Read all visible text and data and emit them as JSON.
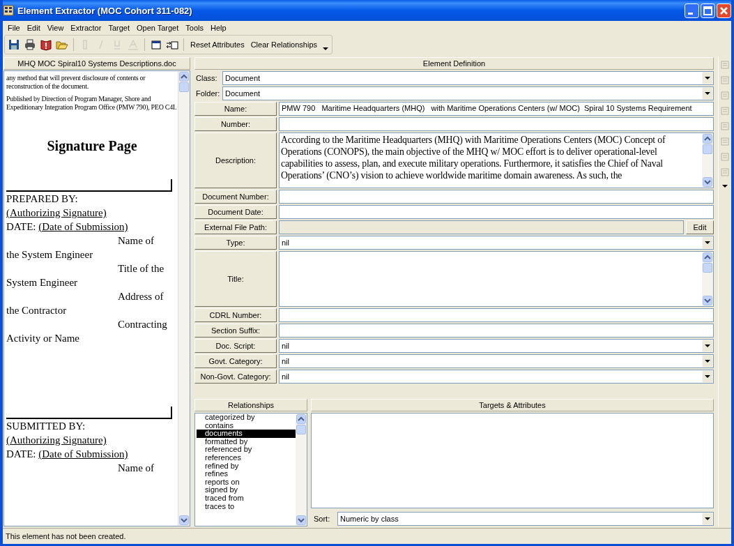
{
  "window": {
    "title": "Element Extractor (MOC Cohort 311-082)"
  },
  "menu": [
    "File",
    "Edit",
    "View",
    "Extractor",
    "Target",
    "Open Target",
    "Tools",
    "Help"
  ],
  "toolbar": {
    "buttons": [
      {
        "kind": "save",
        "disabled": false
      },
      {
        "kind": "print",
        "disabled": false
      },
      {
        "kind": "book",
        "disabled": false
      },
      {
        "kind": "open",
        "disabled": false
      },
      {
        "kind": "sep"
      },
      {
        "kind": "bold",
        "disabled": true
      },
      {
        "kind": "italic",
        "disabled": true
      },
      {
        "kind": "underline",
        "disabled": true
      },
      {
        "kind": "fontcolor",
        "disabled": true
      },
      {
        "kind": "sep"
      },
      {
        "kind": "window",
        "disabled": false
      },
      {
        "kind": "arrowwindow",
        "disabled": false
      }
    ],
    "text_buttons": [
      "Reset Attributes",
      "Clear Relationships"
    ]
  },
  "document": {
    "title": "MHQ MOC Spiral10 Systems Descriptions.doc",
    "blocks": [
      {
        "kind": "small",
        "text": "any method that will prevent disclosure of contents or reconstruction of the document."
      },
      {
        "kind": "small",
        "text": "Published by Direction of Program Manager, Shore and Expeditionary Integration Program Office (PMW 790), PEO C4I."
      },
      {
        "kind": "heading",
        "text": "Signature Page"
      },
      {
        "kind": "rule"
      },
      {
        "kind": "line",
        "text": "PREPARED BY:"
      },
      {
        "kind": "underlined",
        "text": "(Authorizing Signature)"
      },
      {
        "kind": "date",
        "label": "DATE:",
        "text": "(Date of Submission)"
      },
      {
        "kind": "indent",
        "text": "Name of"
      },
      {
        "kind": "line",
        "text": "the System Engineer"
      },
      {
        "kind": "indent",
        "text": "Title of the"
      },
      {
        "kind": "line",
        "text": "System Engineer"
      },
      {
        "kind": "indent",
        "text": "Address of"
      },
      {
        "kind": "line",
        "text": "the Contractor"
      },
      {
        "kind": "indent",
        "text": "Contracting"
      },
      {
        "kind": "line",
        "text": "Activity or Name"
      },
      {
        "kind": "gap"
      },
      {
        "kind": "rule"
      },
      {
        "kind": "line",
        "text": "SUBMITTED BY:"
      },
      {
        "kind": "underlined",
        "text": "(Authorizing Signature)"
      },
      {
        "kind": "date",
        "label": "DATE:",
        "text": "(Date of Submission)"
      },
      {
        "kind": "indent",
        "text": "Name of"
      }
    ]
  },
  "definition": {
    "title": "Element Definition",
    "class": {
      "label": "Class:",
      "value": "Document"
    },
    "folder": {
      "label": "Folder:",
      "value": "Document"
    },
    "fields": [
      {
        "label": "Name:",
        "kind": "text",
        "value": "PMW 790   Maritime Headquarters (MHQ)   with Maritime Operations Centers (w/ MOC)  Spiral 10 Systems Requirement"
      },
      {
        "label": "Number:",
        "kind": "text"
      },
      {
        "label": "Description:",
        "kind": "memo",
        "value": "According to the Maritime Headquarters (MHQ) with Maritime Operations Centers (MOC) Concept of Operations (CONOPS), the main objective of the MHQ w/ MOC effort is to deliver operational-level capabilities to assess, plan, and execute military operations.   Furthermore, it satisfies the Chief of Naval Operations’ (CNO’s) vision to achieve worldwide maritime domain awareness.  As such, the"
      },
      {
        "label": "Document Number:",
        "kind": "text"
      },
      {
        "label": "Document Date:",
        "kind": "text"
      },
      {
        "label": "External File Path:",
        "kind": "path",
        "button": "Edit"
      },
      {
        "label": "Type:",
        "kind": "combo",
        "value": "nil"
      },
      {
        "label": "Title:",
        "kind": "memo"
      },
      {
        "label": "CDRL Number:",
        "kind": "text"
      },
      {
        "label": "Section Suffix:",
        "kind": "text"
      },
      {
        "label": "Doc. Script:",
        "kind": "combo",
        "value": "nil"
      },
      {
        "label": "Govt. Category:",
        "kind": "combo",
        "value": "nil"
      },
      {
        "label": "Non-Govt. Category:",
        "kind": "combo",
        "value": "nil"
      }
    ]
  },
  "relationships": {
    "title": "Relationships",
    "items": [
      {
        "label": "categorized by",
        "selected": false
      },
      {
        "label": "contains",
        "selected": false
      },
      {
        "label": "documents",
        "selected": true
      },
      {
        "label": "formatted by",
        "selected": false
      },
      {
        "label": "referenced by",
        "selected": false
      },
      {
        "label": "references",
        "selected": false
      },
      {
        "label": "refined by",
        "selected": false
      },
      {
        "label": "refines",
        "selected": false
      },
      {
        "label": "reports on",
        "selected": false
      },
      {
        "label": "signed by",
        "selected": false
      },
      {
        "label": "traced from",
        "selected": false
      },
      {
        "label": "traces to",
        "selected": false
      }
    ]
  },
  "targets": {
    "title": "Targets & Attributes",
    "sort_label": "Sort:",
    "sort_value": "Numeric by class"
  },
  "status_bar": "This element has not been created."
}
